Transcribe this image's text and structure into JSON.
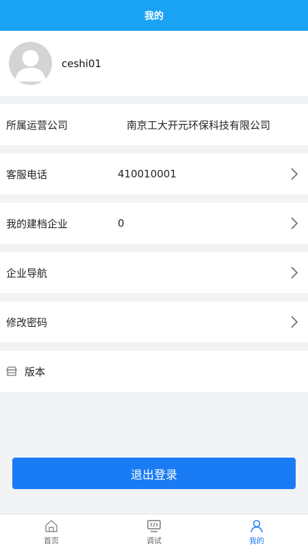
{
  "header": {
    "title": "我的"
  },
  "profile": {
    "username": "ceshi01"
  },
  "company": {
    "label": "所属运营公司",
    "value": "南京工大开元环保科技有限公司"
  },
  "service_phone": {
    "label": "客服电话",
    "value": "410010001"
  },
  "enterprises": {
    "label": "我的建档企业",
    "value": "0"
  },
  "navigation": {
    "label": "企业导航"
  },
  "password": {
    "label": "修改密码"
  },
  "version": {
    "label": "版本",
    "icon": "store-icon"
  },
  "logout": {
    "label": "退出登录"
  },
  "tabbar": {
    "items": [
      {
        "label": "首页",
        "icon": "home-icon"
      },
      {
        "label": "调试",
        "icon": "code-monitor-icon"
      },
      {
        "label": "我的",
        "icon": "user-icon"
      }
    ],
    "active_index": 2
  },
  "colors": {
    "header": "#1aa3f5",
    "accent": "#1a7cf5",
    "background": "#f2f3f5"
  }
}
